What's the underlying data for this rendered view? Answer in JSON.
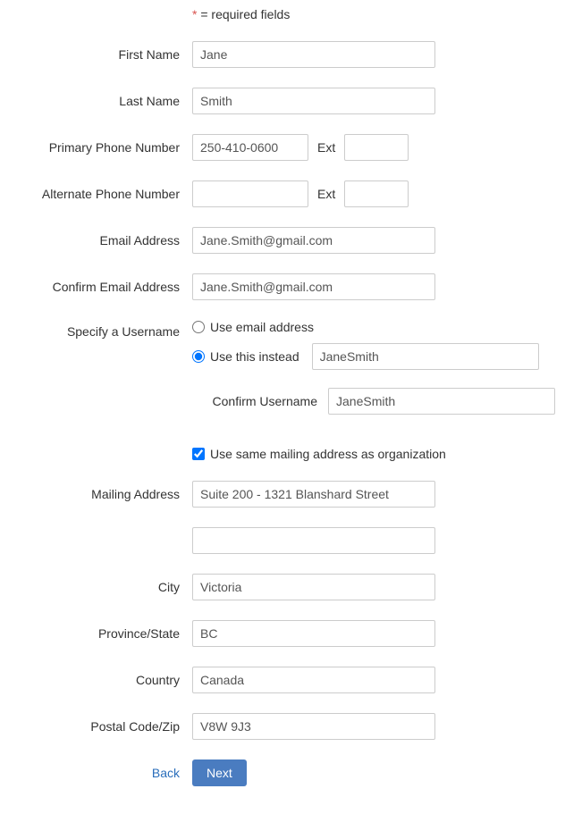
{
  "requiredNote": {
    "star": "*",
    "text": "= required fields"
  },
  "labels": {
    "firstName": "First Name",
    "lastName": "Last Name",
    "primaryPhone": "Primary Phone Number",
    "alternatePhone": "Alternate Phone Number",
    "ext": "Ext",
    "email": "Email Address",
    "confirmEmail": "Confirm Email Address",
    "specifyUsername": "Specify a Username",
    "useEmail": "Use email address",
    "useThis": "Use this instead",
    "confirmUsername": "Confirm Username",
    "sameMailing": "Use same mailing address as organization",
    "mailingAddress": "Mailing Address",
    "city": "City",
    "province": "Province/State",
    "country": "Country",
    "postalCode": "Postal Code/Zip",
    "back": "Back",
    "next": "Next"
  },
  "values": {
    "firstName": "Jane",
    "lastName": "Smith",
    "primaryPhone": "250-410-0600",
    "primaryExt": "",
    "alternatePhone": "",
    "alternateExt": "",
    "email": "Jane.Smith@gmail.com",
    "confirmEmail": "Jane.Smith@gmail.com",
    "username": "JaneSmith",
    "confirmUsername": "JaneSmith",
    "mailing1": "Suite 200 - 1321 Blanshard Street",
    "mailing2": "",
    "city": "Victoria",
    "province": "BC",
    "country": "Canada",
    "postalCode": "V8W 9J3"
  }
}
